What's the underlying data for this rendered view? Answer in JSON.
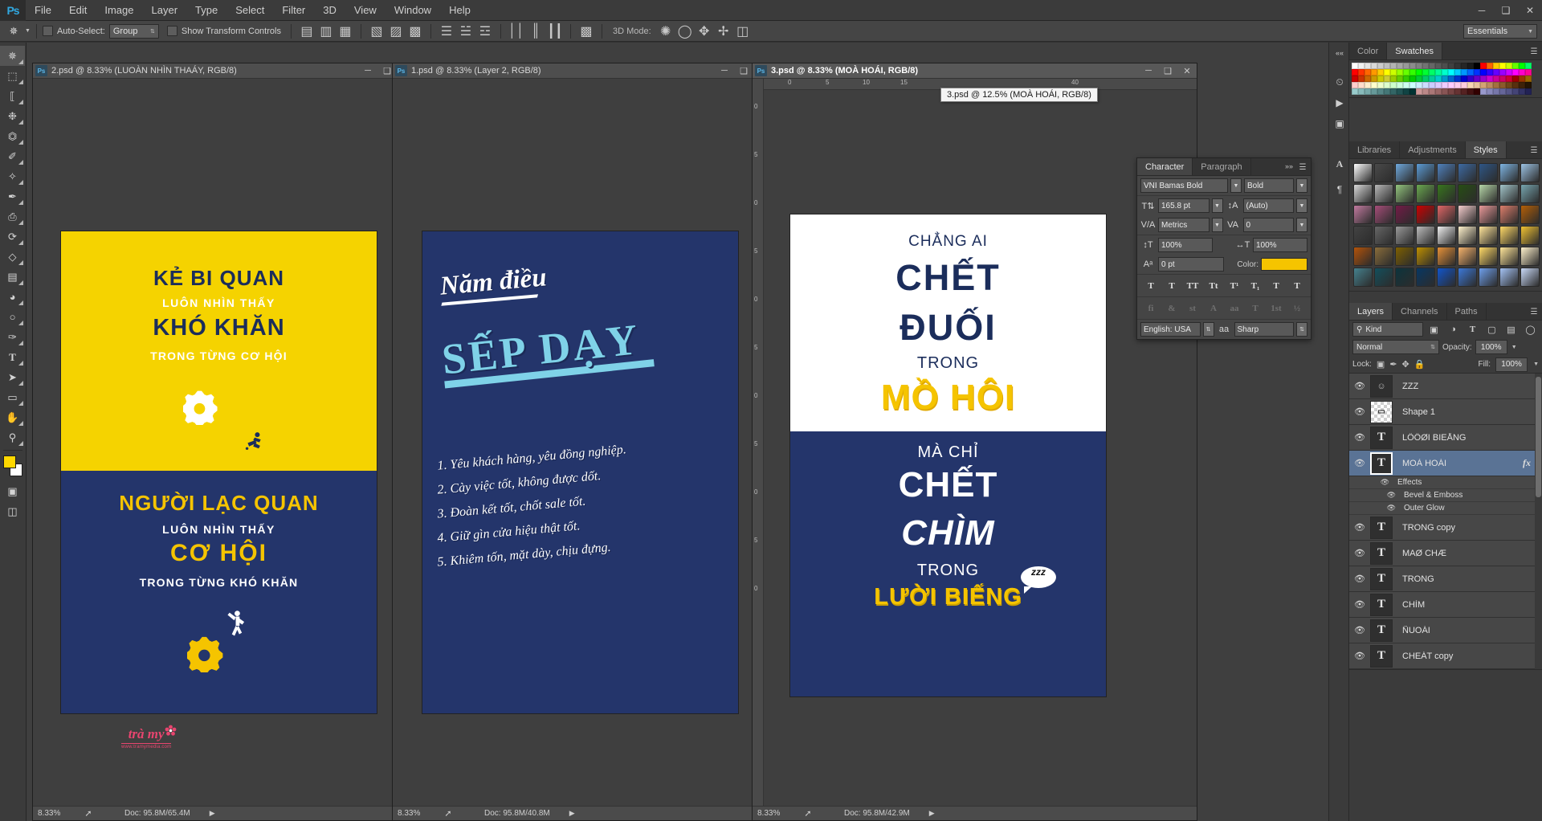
{
  "app": {
    "name": "Adobe Photoshop",
    "logo_text": "Ps"
  },
  "menubar": {
    "items": [
      "File",
      "Edit",
      "Image",
      "Layer",
      "Type",
      "Select",
      "Filter",
      "3D",
      "View",
      "Window",
      "Help"
    ],
    "window_controls": [
      "minimize",
      "restore",
      "close"
    ]
  },
  "options_bar": {
    "tool_icon": "move-tool-icon",
    "auto_select_label": "Auto-Select:",
    "auto_select_value": "Group",
    "show_transform_label": "Show Transform Controls",
    "mode_3d_label": "3D Mode:",
    "workspace": "Essentials"
  },
  "toolbar": {
    "tools": [
      {
        "name": "move-tool",
        "glyph": "✥"
      },
      {
        "name": "marquee-tool",
        "glyph": "⬚"
      },
      {
        "name": "lasso-tool",
        "glyph": "❦"
      },
      {
        "name": "quick-selection-tool",
        "glyph": "❁"
      },
      {
        "name": "crop-tool",
        "glyph": "⌦"
      },
      {
        "name": "eyedropper-tool",
        "glyph": "✐"
      },
      {
        "name": "spot-healing-tool",
        "glyph": "✧"
      },
      {
        "name": "brush-tool",
        "glyph": "✒"
      },
      {
        "name": "clone-stamp-tool",
        "glyph": "⎙"
      },
      {
        "name": "history-brush-tool",
        "glyph": "⟳"
      },
      {
        "name": "eraser-tool",
        "glyph": "◧"
      },
      {
        "name": "gradient-tool",
        "glyph": "▤"
      },
      {
        "name": "blur-tool",
        "glyph": "◕"
      },
      {
        "name": "dodge-tool",
        "glyph": "○"
      },
      {
        "name": "pen-tool",
        "glyph": "✑"
      },
      {
        "name": "type-tool",
        "glyph": "T"
      },
      {
        "name": "path-selection-tool",
        "glyph": "➤"
      },
      {
        "name": "rectangle-tool",
        "glyph": "▭"
      },
      {
        "name": "hand-tool",
        "glyph": "✋"
      },
      {
        "name": "zoom-tool",
        "glyph": "⚲"
      }
    ],
    "foreground_color": "#ffd800",
    "background_color": "#ffffff"
  },
  "documents": [
    {
      "id": "doc1",
      "title": "2.psd @ 8.33% (LUOÀN NHÌN THAÁY, RGB/8)",
      "zoom": "8.33%",
      "doc_size": "Doc: 95.8M/65.4M",
      "active": false,
      "poster": {
        "top_bg": "#f5d300",
        "bottom_bg": "#24356b",
        "top_lines": [
          {
            "text": "KẺ BI QUAN",
            "style": "dark-big"
          },
          {
            "text": "LUÔN NHÌN THẤY",
            "style": "white-small"
          },
          {
            "text": "KHÓ KHĂN",
            "style": "dark-xl"
          },
          {
            "text": "TRONG TỪNG CƠ HỘI",
            "style": "white-small"
          }
        ],
        "bottom_lines": [
          {
            "text": "NGƯỜI LẠC QUAN",
            "style": "yellow-big"
          },
          {
            "text": "LUÔN NHÌN THẤY",
            "style": "white-small"
          },
          {
            "text": "CƠ HỘI",
            "style": "yellow-xl"
          },
          {
            "text": "TRONG TỪNG KHÓ KHĂN",
            "style": "white-small"
          }
        ],
        "logo_name": "trà my",
        "logo_url": "www.tramymedia.com"
      }
    },
    {
      "id": "doc2",
      "title": "1.psd @ 8.33% (Layer 2, RGB/8)",
      "zoom": "8.33%",
      "doc_size": "Doc: 95.8M/40.8M",
      "active": false,
      "poster": {
        "bg": "#24356b",
        "script_title": "Năm điều",
        "headline": "SẾP DẠY",
        "list": [
          "1. Yêu khách hàng, yêu đồng nghiệp.",
          "2. Cày việc tốt, không được dốt.",
          "3. Đoàn kết tốt, chốt sale tốt.",
          "4. Giữ gìn cửa hiệu thật tốt.",
          "5. Khiêm tốn, mặt dày, chịu đựng."
        ]
      }
    },
    {
      "id": "doc3",
      "title": "3.psd @ 8.33% (MOÀ HOÁI, RGB/8)",
      "zoom": "8.33%",
      "doc_size": "Doc: 95.8M/42.9M",
      "active": true,
      "tooltip": "3.psd @ 12.5% (MOÀ HOÁI, RGB/8)",
      "ruler_top_ticks": [
        "0",
        "5",
        "10",
        "15",
        "40"
      ],
      "ruler_left_ticks": [
        "0",
        "5",
        "0",
        "5",
        "0",
        "5",
        "0",
        "5",
        "0",
        "5",
        "0"
      ],
      "poster": {
        "top_bg": "#ffffff",
        "bottom_bg": "#24356b",
        "top_lines": [
          {
            "text": "CHẲNG AI",
            "style": "dark-small"
          },
          {
            "text": "CHẾT",
            "style": "dark-xl"
          },
          {
            "text": "ĐUỐI",
            "style": "dark-xl"
          },
          {
            "text": "TRONG",
            "style": "dark-small"
          },
          {
            "text": "MỒ HÔI",
            "style": "yellow-xl"
          }
        ],
        "bottom_lines": [
          {
            "text": "MÀ CHỈ",
            "style": "white-small"
          },
          {
            "text": "CHẾT",
            "style": "white-xl"
          },
          {
            "text": "CHÌM",
            "style": "white-xl-italic"
          },
          {
            "text": "TRONG",
            "style": "white-small"
          },
          {
            "text": "LƯỜI BIẾNG",
            "style": "yellow-big"
          }
        ],
        "bubble_text": "zzz"
      }
    }
  ],
  "color_panel": {
    "tabs": [
      "Color",
      "Swatches"
    ],
    "active_tab": "Swatches",
    "swatch_colors": [
      "#ffffff",
      "#f2f2f2",
      "#e6e6e6",
      "#d9d9d9",
      "#cccccc",
      "#bfbfbf",
      "#b3b3b3",
      "#a6a6a6",
      "#999999",
      "#8c8c8c",
      "#808080",
      "#737373",
      "#666666",
      "#595959",
      "#4d4d4d",
      "#404040",
      "#333333",
      "#262626",
      "#1a1a1a",
      "#000000",
      "#ff0000",
      "#ff6600",
      "#ffcc00",
      "#ffff00",
      "#ccff00",
      "#66ff00",
      "#00ff00",
      "#00ff66",
      "#ff0000",
      "#ff3300",
      "#ff6600",
      "#ff9900",
      "#ffcc00",
      "#ffff00",
      "#ccff00",
      "#99ff00",
      "#66ff00",
      "#33ff00",
      "#00ff00",
      "#00ff33",
      "#00ff66",
      "#00ff99",
      "#00ffcc",
      "#00ffff",
      "#00ccff",
      "#0099ff",
      "#0066ff",
      "#0033ff",
      "#0000ff",
      "#3300ff",
      "#6600ff",
      "#9900ff",
      "#cc00ff",
      "#ff00ff",
      "#ff00cc",
      "#ff0099",
      "#cc0000",
      "#cc3300",
      "#cc6600",
      "#cc9900",
      "#cccc00",
      "#cccc33",
      "#99cc00",
      "#66cc00",
      "#33cc00",
      "#00cc00",
      "#00cc33",
      "#00cc66",
      "#00cc99",
      "#00cccc",
      "#0099cc",
      "#0066cc",
      "#0033cc",
      "#0000cc",
      "#3300cc",
      "#6600cc",
      "#9900cc",
      "#cc00cc",
      "#cc0099",
      "#cc0066",
      "#cc0033",
      "#990000",
      "#993300",
      "#996600",
      "#ffcccc",
      "#ffddcc",
      "#ffeecc",
      "#ffffcc",
      "#eeffcc",
      "#ddffcc",
      "#ccffcc",
      "#ccffdd",
      "#ccffee",
      "#ccffff",
      "#cceeff",
      "#ccddff",
      "#ccccff",
      "#ddccff",
      "#eeccff",
      "#ffccff",
      "#ffccee",
      "#ffccdd",
      "#f7d7b4",
      "#e8c39e",
      "#d4a373",
      "#bc8a5f",
      "#a3703f",
      "#8b5a2b",
      "#6f4518",
      "#582f0e",
      "#3d2208",
      "#241503",
      "#99cccc",
      "#88bbbb",
      "#77aaaa",
      "#669999",
      "#558888",
      "#447777",
      "#336666",
      "#225555",
      "#114444",
      "#003333",
      "#cc9999",
      "#bb8888",
      "#aa7777",
      "#996666",
      "#885555",
      "#774444",
      "#663333",
      "#552222",
      "#441111",
      "#330000",
      "#9999cc",
      "#8888bb",
      "#7777aa",
      "#666699",
      "#555588",
      "#444477",
      "#333366",
      "#222255"
    ]
  },
  "adjustments_panel": {
    "tabs": [
      "Libraries",
      "Adjustments",
      "Styles"
    ],
    "active_tab": "Styles",
    "style_swatches": [
      "#ffffff",
      "#4a4a4a",
      "#6fa8dc",
      "#5b9bd5",
      "#4f81bd",
      "#3d6aa3",
      "#2e5686",
      "#7eb4e2",
      "#9cc3e5",
      "#d9d9d9",
      "#b7b7b7",
      "#93c47d",
      "#6aa84f",
      "#38761d",
      "#274e13",
      "#b6d7a8",
      "#a2c4c9",
      "#76a5af",
      "#c27ba0",
      "#a64d79",
      "#741b47",
      "#cc0000",
      "#e06666",
      "#f4cccc",
      "#ea9999",
      "#dd7e6b",
      "#b45f06",
      "#434343",
      "#666666",
      "#999999",
      "#bcbcbc",
      "#efefef",
      "#fff2cc",
      "#ffe599",
      "#ffd966",
      "#f1c232",
      "#b45309",
      "#8a6d3b",
      "#7f6000",
      "#bf9000",
      "#e69138",
      "#f6b26b",
      "#ffd966",
      "#ffe599",
      "#fff2cc",
      "#45818e",
      "#134f5c",
      "#0c343d",
      "#073763",
      "#1155cc",
      "#3c78d8",
      "#6d9eeb",
      "#a4c2f4",
      "#c9daf8"
    ]
  },
  "character_panel": {
    "tabs": [
      "Character",
      "Paragraph"
    ],
    "active_tab": "Character",
    "font_family": "VNI Bamas Bold",
    "font_style": "Bold",
    "font_size": "165.8 pt",
    "leading": "(Auto)",
    "kerning": "Metrics",
    "tracking": "0",
    "vertical_scale": "100%",
    "horizontal_scale": "100%",
    "baseline_shift": "0 pt",
    "color_label": "Color:",
    "color_value": "#f5c400",
    "language": "English: USA",
    "anti_alias": "Sharp",
    "style_buttons": [
      "T",
      "T",
      "TT",
      "Tt",
      "T¹",
      "T₁",
      "T",
      "T"
    ],
    "ot_buttons": [
      "fi",
      "&",
      "st",
      "A",
      "aa",
      "T",
      "1st",
      "½"
    ]
  },
  "layers_panel": {
    "tabs": [
      "Layers",
      "Channels",
      "Paths"
    ],
    "active_tab": "Layers",
    "kind_label": "Kind",
    "filter_icons": [
      "image-filter-icon",
      "adjustment-filter-icon",
      "type-filter-icon",
      "shape-filter-icon",
      "smart-object-filter-icon"
    ],
    "blend_mode": "Normal",
    "opacity_label": "Opacity:",
    "opacity_value": "100%",
    "lock_label": "Lock:",
    "fill_label": "Fill:",
    "fill_value": "100%",
    "layers": [
      {
        "name": "ZZZ",
        "type": "raster",
        "visible": true,
        "selected": false,
        "fx": false
      },
      {
        "name": "Shape 1",
        "type": "shape",
        "visible": true,
        "selected": false,
        "fx": false
      },
      {
        "name": "LÖÖØI BIEÅNG",
        "type": "text",
        "visible": true,
        "selected": false,
        "fx": false
      },
      {
        "name": "MOÀ HOÁI",
        "type": "text",
        "visible": true,
        "selected": true,
        "fx": true,
        "effects": {
          "label": "Effects",
          "items": [
            "Bevel & Emboss",
            "Outer Glow"
          ]
        }
      },
      {
        "name": "TRONG copy",
        "type": "text",
        "visible": true,
        "selected": false,
        "fx": false
      },
      {
        "name": "MAØ CHÆ",
        "type": "text",
        "visible": true,
        "selected": false,
        "fx": false
      },
      {
        "name": "TRONG",
        "type": "text",
        "visible": true,
        "selected": false,
        "fx": false
      },
      {
        "name": "CHÌM",
        "type": "text",
        "visible": true,
        "selected": false,
        "fx": false
      },
      {
        "name": "ÑUOÁI",
        "type": "text",
        "visible": true,
        "selected": false,
        "fx": false
      },
      {
        "name": "CHEÁT copy",
        "type": "text",
        "visible": true,
        "selected": false,
        "fx": false
      }
    ]
  }
}
